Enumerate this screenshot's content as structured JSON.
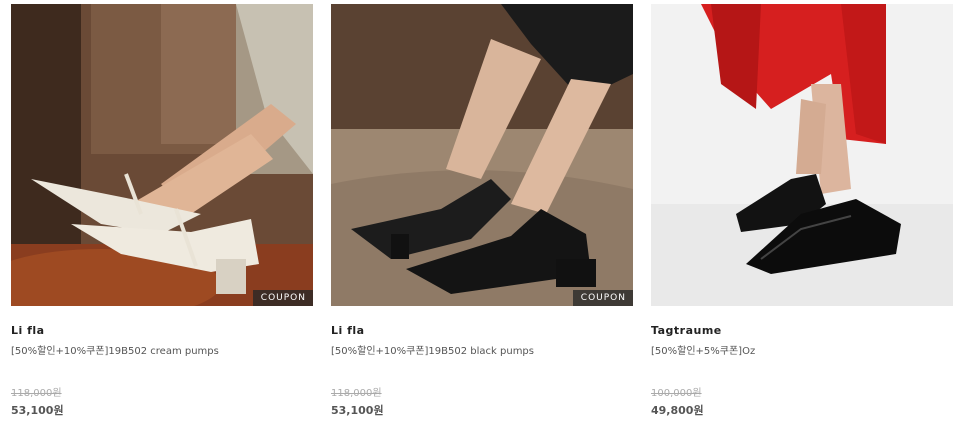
{
  "products": [
    {
      "image_alt": "cream pumps",
      "coupon_badge": "COUPON",
      "brand": "Li fla",
      "name": "[50%할인+10%쿠폰]19B502 cream pumps",
      "original_price": "118,000원",
      "sale_price": "53,100원"
    },
    {
      "image_alt": "black pumps",
      "coupon_badge": "COUPON",
      "brand": "Li fla",
      "name": "[50%할인+10%쿠폰]19B502 black pumps",
      "original_price": "118,000원",
      "sale_price": "53,100원"
    },
    {
      "image_alt": "black oxford shoes",
      "brand": "Tagtraume",
      "name": "[50%할인+5%쿠폰]Oz",
      "original_price": "100,000원",
      "sale_price": "49,800원"
    }
  ]
}
